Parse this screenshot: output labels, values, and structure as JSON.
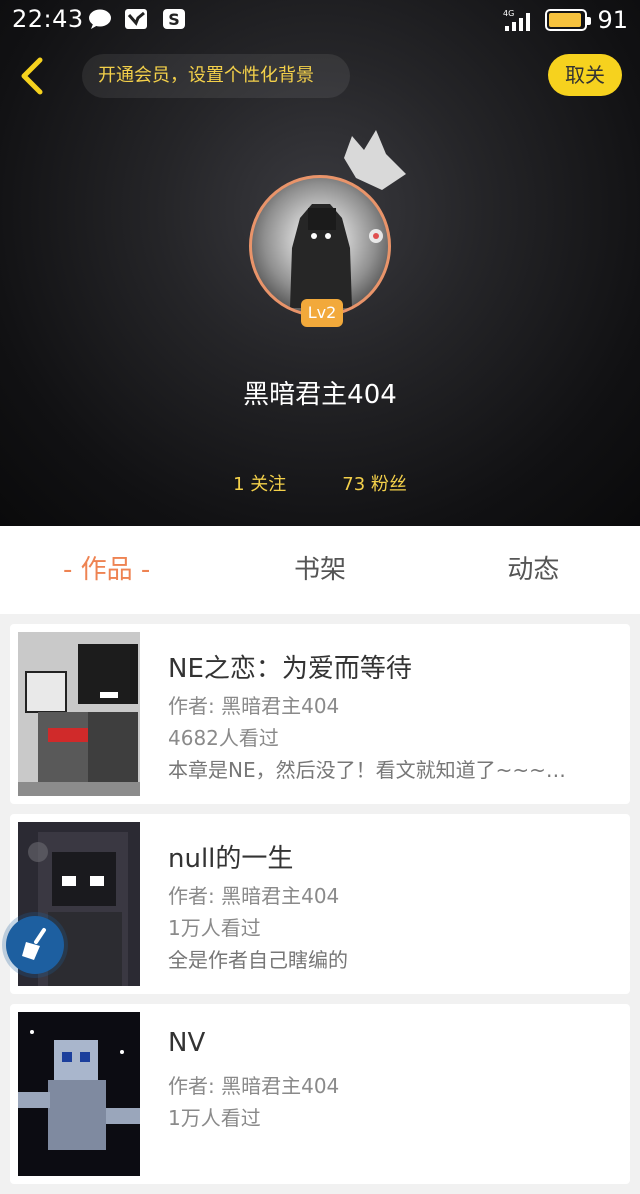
{
  "status": {
    "time": "22:43",
    "network": "4G",
    "battery": "91",
    "battery_level": 0.91
  },
  "header": {
    "vip_banner": "开通会员，设置个性化背景",
    "fav_button": "取关"
  },
  "profile": {
    "level": "Lv2",
    "username": "黑暗君主404",
    "following": "1 关注",
    "followers": "73 粉丝"
  },
  "tabs": [
    {
      "label": "- 作品 -",
      "active": true
    },
    {
      "label": "书架",
      "active": false
    },
    {
      "label": "动态",
      "active": false
    }
  ],
  "works": [
    {
      "title": "NE之恋：为爱而等待",
      "author": "作者: 黑暗君主404",
      "views": "4682人看过",
      "summary": "本章是NE，然后没了！看文就知道了~~~…"
    },
    {
      "title": "null的一生",
      "author": "作者: 黑暗君主404",
      "views": "1万人看过",
      "summary": "全是作者自己瞎编的"
    },
    {
      "title": "NV",
      "author": "作者: 黑暗君主404",
      "views": "1万人看过",
      "summary": ""
    }
  ],
  "colors": {
    "accent": "#ee8352",
    "yellow": "#f6d21e",
    "gold_text": "#f3d04a",
    "level_badge": "#f2a93b"
  },
  "icons": [
    "chat-bubble-icon",
    "notification-icon",
    "sogou-icon",
    "signal-icon",
    "battery-icon",
    "back-arrow-icon",
    "crown-icon",
    "broom-icon"
  ]
}
